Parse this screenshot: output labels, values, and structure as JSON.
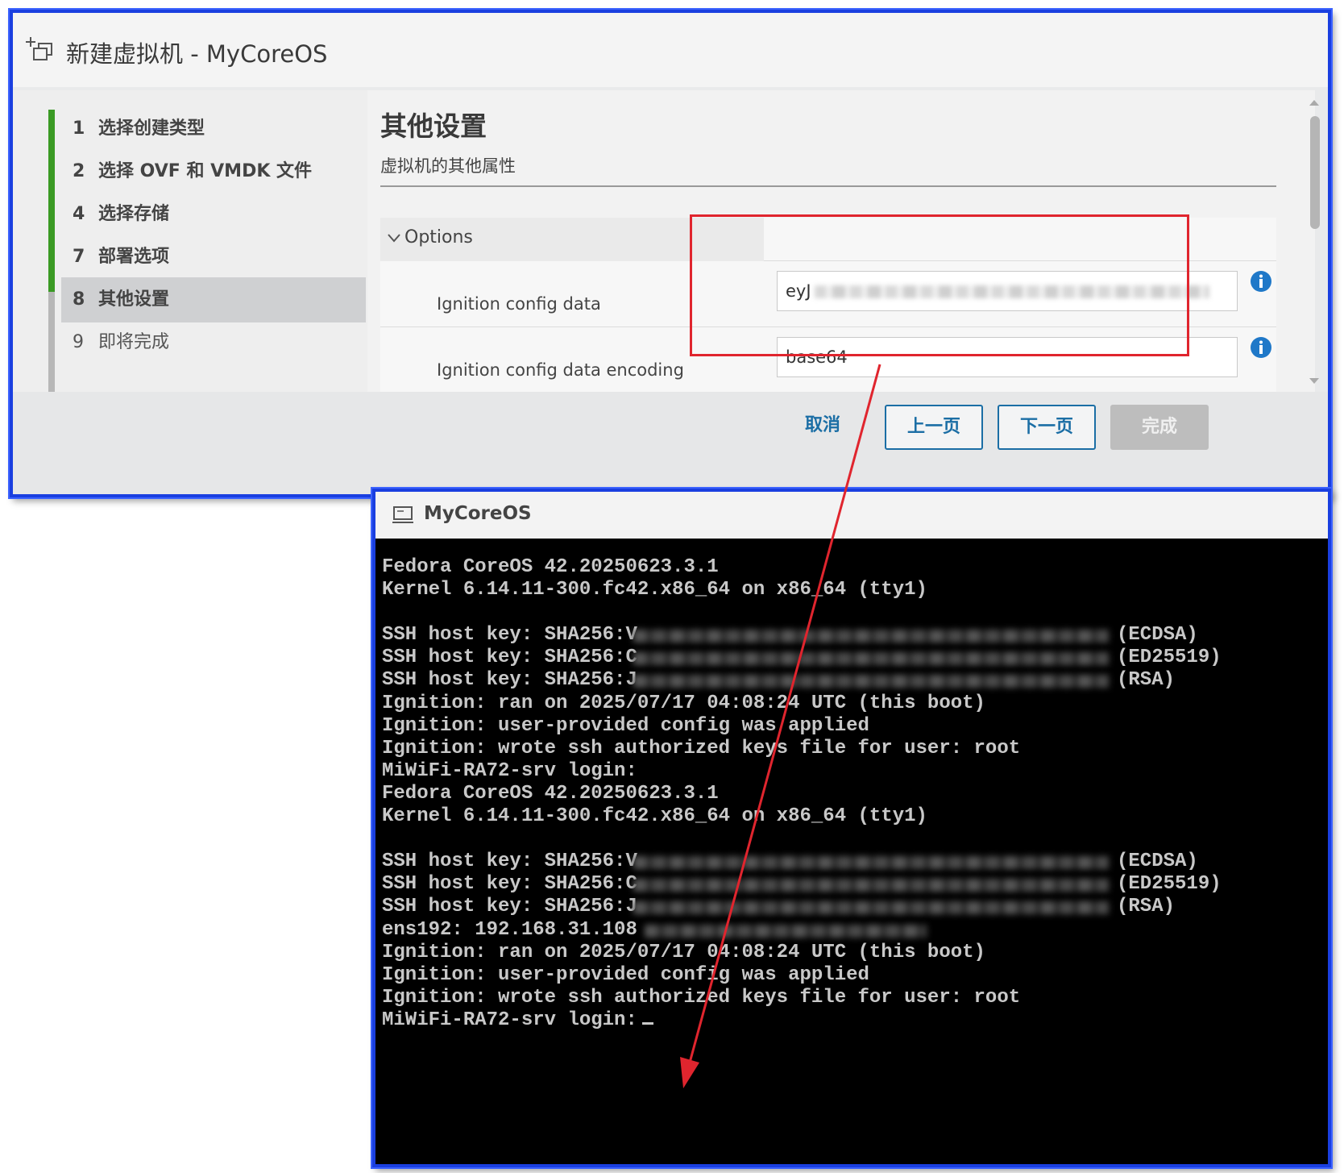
{
  "wizard": {
    "title": "新建虚拟机 - MyCoreOS",
    "steps": [
      {
        "num": "1",
        "label": "选择创建类型"
      },
      {
        "num": "2",
        "label": "选择 OVF 和 VMDK 文件"
      },
      {
        "num": "4",
        "label": "选择存储"
      },
      {
        "num": "7",
        "label": "部署选项"
      },
      {
        "num": "8",
        "label": "其他设置"
      },
      {
        "num": "9",
        "label": "即将完成"
      }
    ],
    "heading": "其他设置",
    "subheading": "虚拟机的其他属性",
    "group_label": "Options",
    "options": [
      {
        "label": "Ignition config data",
        "value": "eyJ"
      },
      {
        "label": "Ignition config data encoding",
        "value": "base64"
      }
    ],
    "buttons": {
      "cancel": "取消",
      "prev": "上一页",
      "next": "下一页",
      "finish": "完成"
    }
  },
  "console": {
    "title": "MyCoreOS",
    "lines": [
      "Fedora CoreOS 42.20250623.3.1",
      "Kernel 6.14.11-300.fc42.x86_64 on x86_64 (tty1)",
      "",
      "SSH host key: SHA256:V",
      "SSH host key: SHA256:C",
      "SSH host key: SHA256:J",
      "Ignition: ran on 2025/07/17 04:08:24 UTC (this boot)",
      "Ignition: user-provided config was applied",
      "Ignition: wrote ssh authorized keys file for user: root",
      "MiWiFi-RA72-srv login:",
      "Fedora CoreOS 42.20250623.3.1",
      "Kernel 6.14.11-300.fc42.x86_64 on x86_64 (tty1)",
      "",
      "SSH host key: SHA256:V",
      "SSH host key: SHA256:C",
      "SSH host key: SHA256:J",
      "ens192: 192.168.31.108",
      "Ignition: ran on 2025/07/17 04:08:24 UTC (this boot)",
      "Ignition: user-provided config was applied",
      "Ignition: wrote ssh authorized keys file for user: root",
      "MiWiFi-RA72-srv login:"
    ],
    "key_types": [
      "(ECDSA)",
      "(ED25519)",
      "(RSA)"
    ]
  },
  "colors": {
    "highlight": "#e0252e",
    "frame": "#1a3fe0",
    "accent": "#1b6ea5",
    "completed_step": "#3a9a24"
  }
}
